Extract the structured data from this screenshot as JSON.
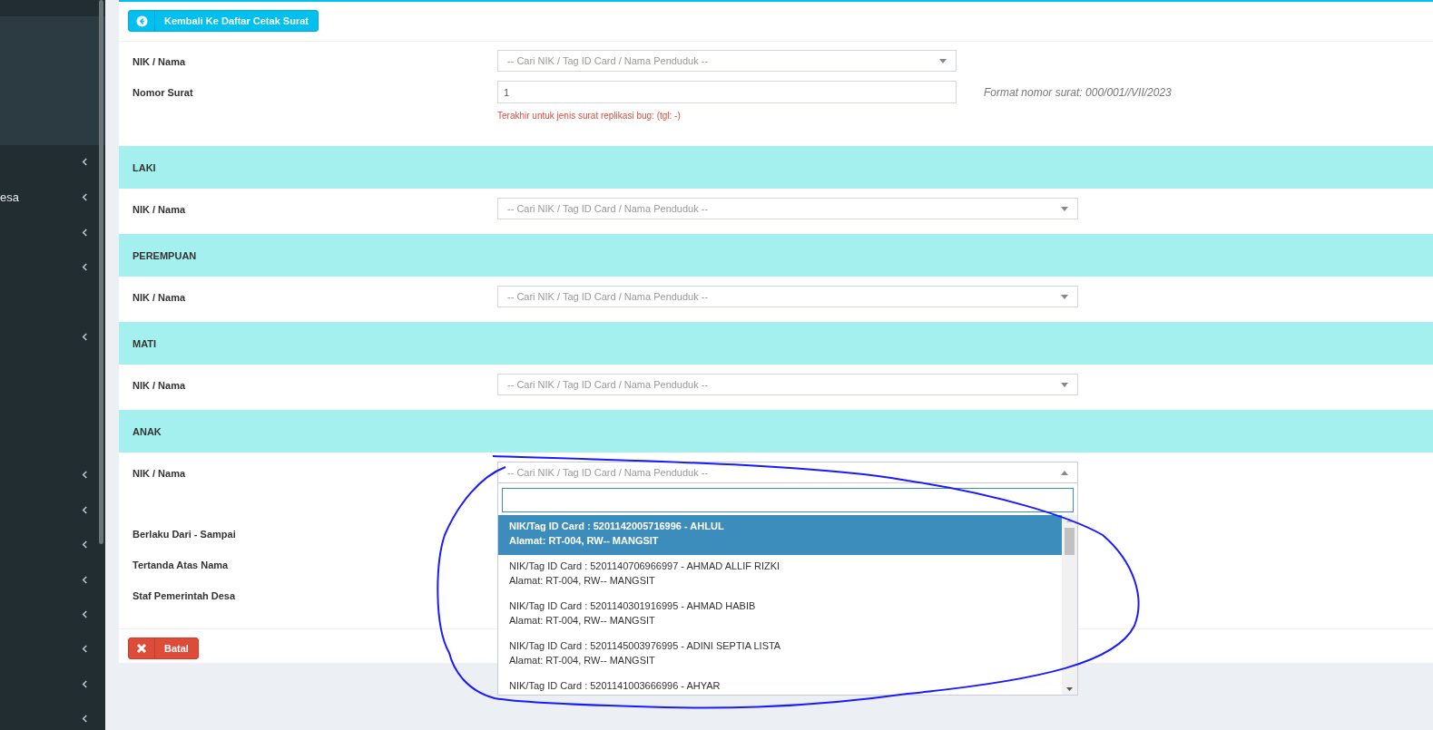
{
  "sidebar": {
    "items": [
      {
        "expanded": false
      },
      {
        "label": "esa",
        "expanded": false
      },
      {
        "expanded": false
      },
      {
        "expanded": false
      },
      {
        "expanded": false
      },
      {
        "expanded": false
      },
      {
        "expanded": false
      },
      {
        "expanded": false
      },
      {
        "expanded": false
      },
      {
        "expanded": false
      },
      {
        "expanded": false
      },
      {
        "expanded": false
      },
      {
        "expanded": false
      }
    ]
  },
  "back_button": "Kembali Ke Daftar Cetak Surat",
  "header_fields": [
    {
      "label": "NIK / Nama",
      "kind": "select",
      "placeholder": "-- Cari NIK / Tag ID Card / Nama Penduduk --"
    },
    {
      "label": "Nomor Surat",
      "kind": "text",
      "value": "1",
      "error": "Terakhir untuk jenis surat replikasi bug: (tgl: -)",
      "hint": "Format nomor surat: 000/001//VII/2023"
    }
  ],
  "sections": [
    {
      "title": "LAKI",
      "label": "NIK / Nama",
      "placeholder": "-- Cari NIK / Tag ID Card / Nama Penduduk --",
      "expanded": false
    },
    {
      "title": "PEREMPUAN",
      "label": "NIK / Nama",
      "placeholder": "-- Cari NIK / Tag ID Card / Nama Penduduk --",
      "expanded": false
    },
    {
      "title": "MATI",
      "label": "NIK / Nama",
      "placeholder": "-- Cari NIK / Tag ID Card / Nama Penduduk --",
      "expanded": false
    },
    {
      "title": "ANAK",
      "label": "NIK / Nama",
      "placeholder": "-- Cari NIK / Tag ID Card / Nama Penduduk --",
      "expanded": true
    }
  ],
  "dropdown": {
    "options": [
      {
        "line1": "NIK/Tag ID Card : 5201142005716996 - AHLUL",
        "line2": "Alamat: RT-004, RW-- MANGSIT",
        "selected": true
      },
      {
        "line1": "NIK/Tag ID Card : 5201140706966997 - AHMAD ALLIF RIZKI",
        "line2": "Alamat: RT-004, RW-- MANGSIT",
        "selected": false
      },
      {
        "line1": "NIK/Tag ID Card : 5201140301916995 - AHMAD HABIB",
        "line2": "Alamat: RT-004, RW-- MANGSIT",
        "selected": false
      },
      {
        "line1": "NIK/Tag ID Card : 5201145003976995 - ADINI SEPTIA LISTA",
        "line2": "Alamat: RT-004, RW-- MANGSIT",
        "selected": false
      },
      {
        "line1": "NIK/Tag ID Card : 5201141003666996 - AHYAR",
        "selected": false
      }
    ]
  },
  "footer_labels": [
    "Berlaku Dari - Sampai",
    "Tertanda Atas Nama",
    "Staf Pemerintah Desa"
  ],
  "cancel_button": "Batal"
}
